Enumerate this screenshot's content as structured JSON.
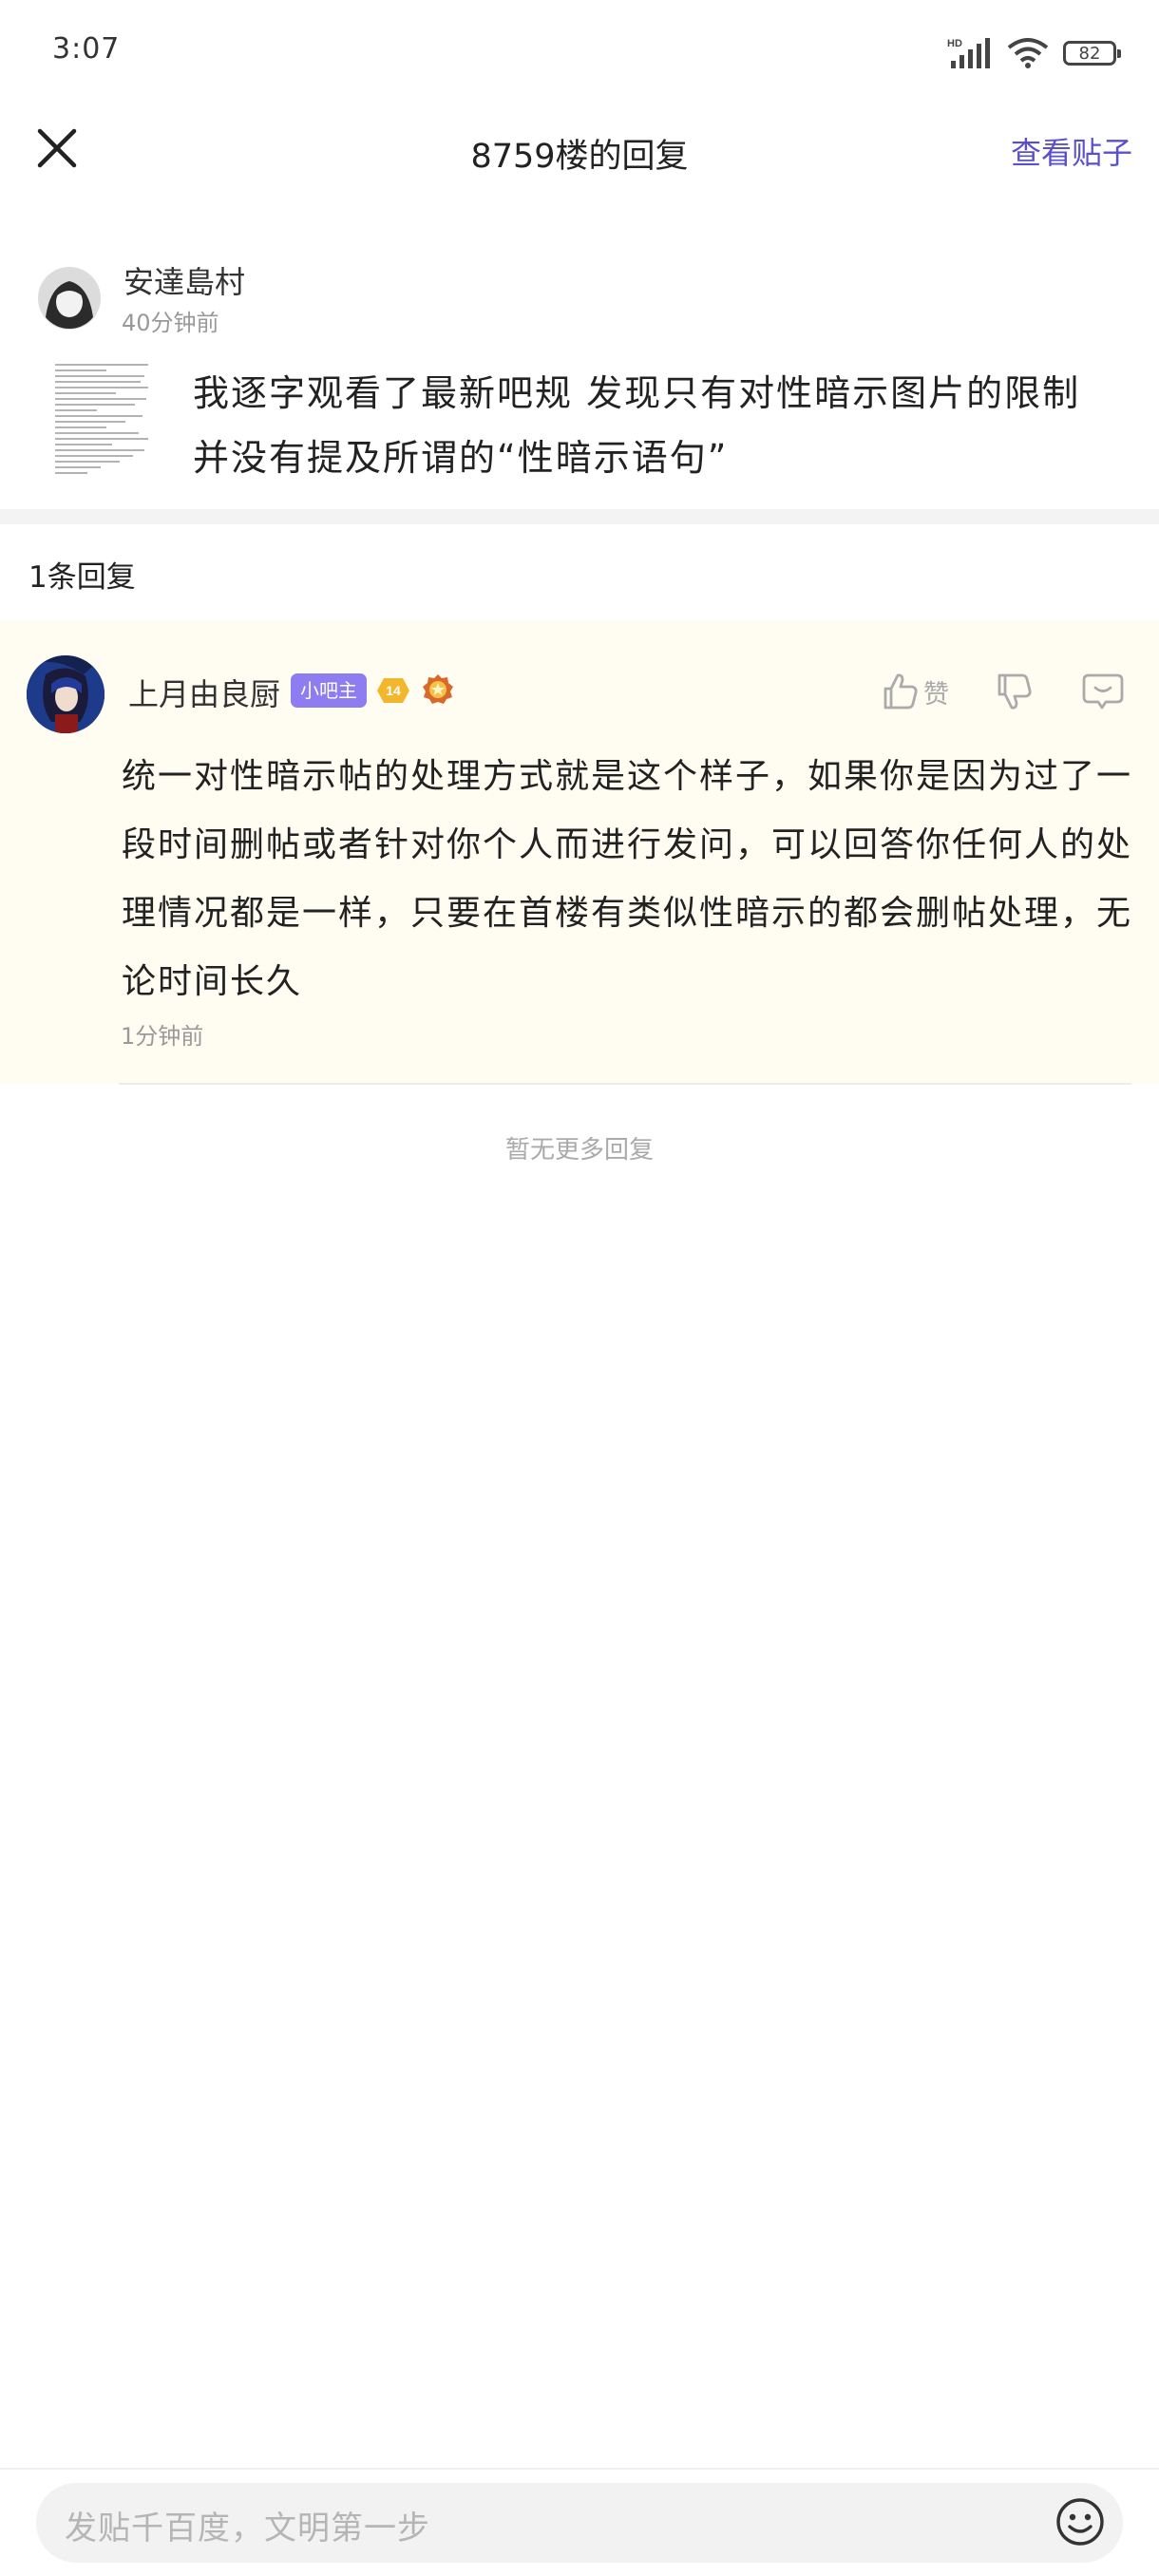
{
  "status_bar": {
    "time": "3:07",
    "battery": "82",
    "icons": [
      "hd-signal-icon",
      "wifi-icon",
      "battery-icon"
    ]
  },
  "header": {
    "close_icon": "close-icon",
    "title": "8759楼的回复",
    "view_post": "查看贴子"
  },
  "original_post": {
    "author": "安達島村",
    "time": "40分钟前",
    "text_line1": "我逐字观看了最新吧规 发现只有对性暗示图片的限制",
    "text_line2": "并没有提及所谓的“性暗示语句”"
  },
  "reply_count": "1条回复",
  "reply": {
    "author": "上月由良厨",
    "badge_admin": "小吧主",
    "level": "14",
    "like_label": "赞",
    "text": "统一对性暗示帖的处理方式就是这个样子，如果你是因为过了一段时间删帖或者针对你个人而进行发问，可以回答你任何人的处理情况都是一样，只要在首楼有类似性暗示的都会删帖处理，无论时间长久",
    "time": "1分钟前"
  },
  "no_more": "暂无更多回复",
  "composer": {
    "placeholder": "发贴千百度，文明第一步",
    "emoji_icon": "emoji-icon"
  },
  "colors": {
    "accent": "#5a4fcf",
    "admin_badge": "#8e7df0",
    "level_badge": "#f3b72e",
    "reply_bg": "#fffdf1"
  }
}
